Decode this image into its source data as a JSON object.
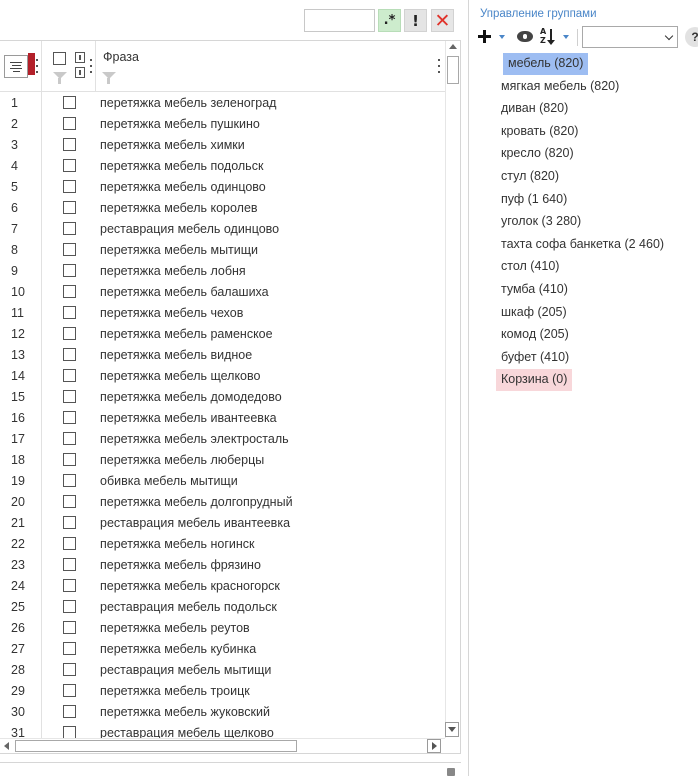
{
  "toolbar": {
    "regex_value": "",
    "regex_label": ".*",
    "exclam_label": "!",
    "clear_label": "✕"
  },
  "grid": {
    "phrase_header": "Фраза",
    "rows": [
      {
        "num": "1",
        "text": "перетяжка мебель зеленоград"
      },
      {
        "num": "2",
        "text": "перетяжка мебель пушкино"
      },
      {
        "num": "3",
        "text": "перетяжка мебель химки"
      },
      {
        "num": "4",
        "text": "перетяжка мебель подольск"
      },
      {
        "num": "5",
        "text": "перетяжка мебель одинцово"
      },
      {
        "num": "6",
        "text": "перетяжка мебель королев"
      },
      {
        "num": "7",
        "text": "реставрация мебель одинцово"
      },
      {
        "num": "8",
        "text": "перетяжка мебель мытищи"
      },
      {
        "num": "9",
        "text": "перетяжка мебель лобня"
      },
      {
        "num": "10",
        "text": "перетяжка мебель балашиха"
      },
      {
        "num": "11",
        "text": "перетяжка мебель чехов"
      },
      {
        "num": "12",
        "text": "перетяжка мебель раменское"
      },
      {
        "num": "13",
        "text": "перетяжка мебель видное"
      },
      {
        "num": "14",
        "text": "перетяжка мебель щелково"
      },
      {
        "num": "15",
        "text": "перетяжка мебель домодедово"
      },
      {
        "num": "16",
        "text": "перетяжка мебель ивантеевка"
      },
      {
        "num": "17",
        "text": "перетяжка мебель электросталь"
      },
      {
        "num": "18",
        "text": "перетяжка мебель люберцы"
      },
      {
        "num": "19",
        "text": "обивка мебель мытищи"
      },
      {
        "num": "20",
        "text": "перетяжка мебель долгопрудный"
      },
      {
        "num": "21",
        "text": "реставрация мебель ивантеевка"
      },
      {
        "num": "22",
        "text": "перетяжка мебель ногинск"
      },
      {
        "num": "23",
        "text": "перетяжка мебель фрязино"
      },
      {
        "num": "24",
        "text": "перетяжка мебель красногорск"
      },
      {
        "num": "25",
        "text": "реставрация мебель подольск"
      },
      {
        "num": "26",
        "text": "перетяжка мебель реутов"
      },
      {
        "num": "27",
        "text": "перетяжка мебель кубинка"
      },
      {
        "num": "28",
        "text": "реставрация мебель мытищи"
      },
      {
        "num": "29",
        "text": "перетяжка мебель троицк"
      },
      {
        "num": "30",
        "text": "перетяжка мебель жуковский"
      },
      {
        "num": "31",
        "text": "реставрация мебель щелково"
      }
    ]
  },
  "groups": {
    "title": "Управление группами",
    "help_label": "?",
    "select_value": "",
    "selected_color": "#9dbdf2",
    "selected_marker_color": "#b3202a",
    "trash_color": "#f8d7da",
    "items": [
      {
        "label": "мебель (820)",
        "state": "selected"
      },
      {
        "label": "мягкая мебель (820)",
        "state": "normal"
      },
      {
        "label": "диван (820)",
        "state": "normal"
      },
      {
        "label": "кровать (820)",
        "state": "normal"
      },
      {
        "label": "кресло (820)",
        "state": "normal"
      },
      {
        "label": "стул (820)",
        "state": "normal"
      },
      {
        "label": "пуф (1 640)",
        "state": "normal"
      },
      {
        "label": "уголок (3 280)",
        "state": "normal"
      },
      {
        "label": "тахта софа банкетка (2 460)",
        "state": "normal"
      },
      {
        "label": "стол (410)",
        "state": "normal"
      },
      {
        "label": "тумба (410)",
        "state": "normal"
      },
      {
        "label": "шкаф (205)",
        "state": "normal"
      },
      {
        "label": "комод (205)",
        "state": "normal"
      },
      {
        "label": "буфет (410)",
        "state": "normal"
      },
      {
        "label": "Корзина (0)",
        "state": "trash"
      }
    ]
  }
}
